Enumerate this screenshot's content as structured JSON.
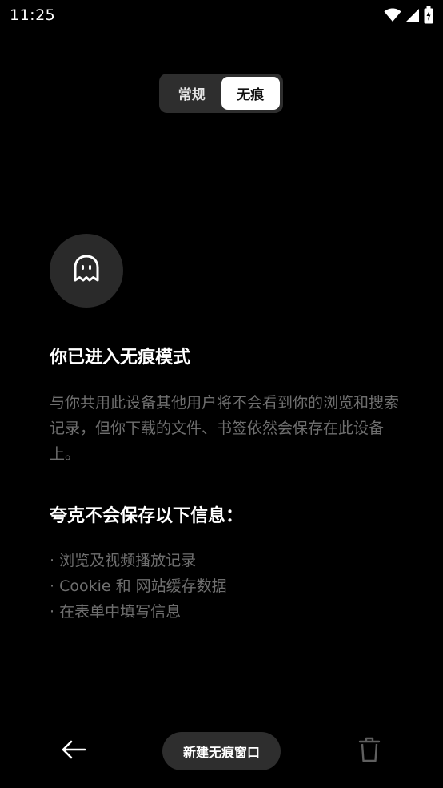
{
  "status_bar": {
    "time": "11:25",
    "icons": [
      "wifi-icon",
      "cellular-signal-icon",
      "battery-icon"
    ]
  },
  "mode_toggle": {
    "options": [
      "常规",
      "无痕"
    ],
    "selected": "无痕"
  },
  "incognito": {
    "icon": "ghost-icon",
    "title": "你已进入无痕模式",
    "description": "与你共用此设备其他用户将不会看到你的浏览和搜索记录，但你下载的文件、书签依然会保存在此设备上。",
    "subtitle": "夸克不会保存以下信息：",
    "items": [
      "· 浏览及视频播放记录",
      "· Cookie 和 网站缓存数据",
      "· 在表单中填写信息"
    ]
  },
  "bottom_bar": {
    "back_icon": "arrow-left-icon",
    "new_window_label": "新建无痕窗口",
    "trash_icon": "trash-icon"
  },
  "colors": {
    "background": "#000000",
    "segment_bg": "#2e2e2e",
    "segment_active": "#ffffff",
    "muted_text": "#6f6f6f",
    "ghost_circle": "#2a2a2a"
  }
}
